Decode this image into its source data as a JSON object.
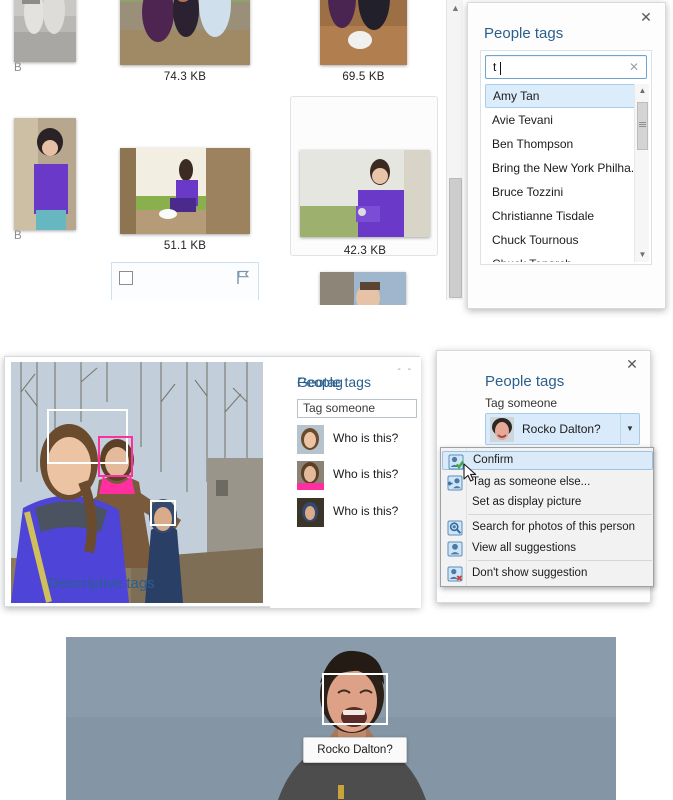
{
  "grid": {
    "items": [
      {
        "size": "74.3 KB"
      },
      {
        "size": "69.5 KB"
      },
      {
        "size": "51.1 KB"
      },
      {
        "size": "42.3 KB"
      }
    ],
    "clipped_labels": [
      "B",
      "B"
    ],
    "scrollbar_up_icon": "chevron-up-icon",
    "checkbox_row": {
      "flag_icon": "flag-icon"
    }
  },
  "people_tags_search": {
    "title": "People tags",
    "close_icon": "close-icon",
    "search_value": "t",
    "search_placeholder": "",
    "clear_icon": "clear-icon",
    "names": [
      "Amy Tan",
      "Avie Tevani",
      "Ben Thompson",
      "Bring the New York Philha...",
      "Bruce Tozzini",
      "Christianne Tisdale",
      "Chuck Tournous",
      "Chuck Tonarch"
    ],
    "selected_name": "Amy Tan",
    "scroll_up_icon": "chevron-up-icon",
    "scroll_down_icon": "chevron-down-icon",
    "accent": "#2b5f8e",
    "selection_bg": "#dbecfb"
  },
  "photo_tag_panel": {
    "title": "People tags",
    "tag_field_value": "Tag someone",
    "suggestions": [
      {
        "label": "Who is this?"
      },
      {
        "label": "Who is this?"
      },
      {
        "label": "Who is this?"
      }
    ],
    "geotag_label": "Geotag",
    "window_buttons": "- -"
  },
  "suggestion_panel": {
    "title": "People tags",
    "close_icon": "close-icon",
    "tag_someone_label": "Tag someone",
    "suggested_name": "Rocko Dalton?",
    "dropdown_icon": "chevron-down-icon",
    "descriptive_tags_label": "Descriptive tags"
  },
  "context_menu": {
    "items": [
      {
        "label": "Confirm",
        "icon": "person-confirm-icon",
        "highlighted": true
      },
      {
        "label": "Tag as someone else...",
        "icon": "person-swap-icon",
        "highlighted": false
      },
      {
        "label": "Set as display picture",
        "icon": "",
        "highlighted": false
      },
      {
        "label": "Search for photos of this person",
        "icon": "person-search-icon",
        "highlighted": false
      },
      {
        "label": "View all suggestions",
        "icon": "person-icon",
        "highlighted": false
      },
      {
        "label": "Don't show suggestion",
        "icon": "person-remove-icon",
        "highlighted": false
      }
    ],
    "cursor_icon": "mouse-pointer-icon",
    "highlight_bg": "#dbeaf8"
  },
  "bottom_photo": {
    "tooltip_label": "Rocko Dalton?",
    "face_box_icon": "face-detection-box"
  }
}
